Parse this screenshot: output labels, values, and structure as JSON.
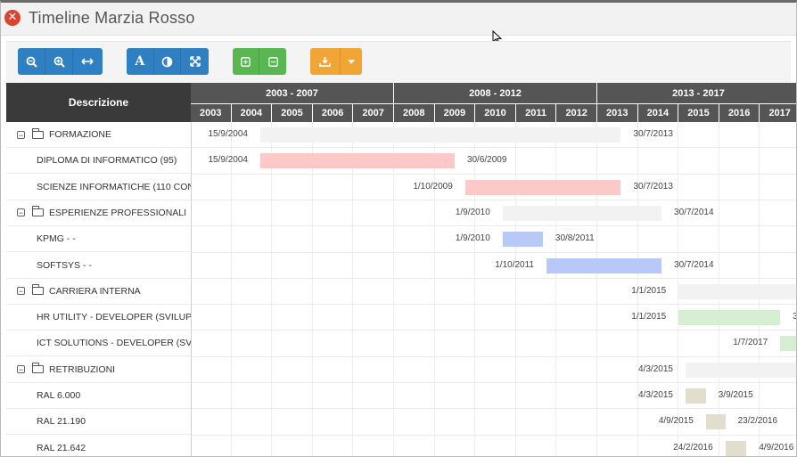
{
  "window": {
    "title": "Timeline Marzia Rosso",
    "close_icon": "close-icon"
  },
  "toolbar": {
    "zoom_out": "zoom-out-icon",
    "zoom_in": "zoom-in-icon",
    "fit": "fit-width-icon",
    "font": "A",
    "contrast": "contrast-icon",
    "fullscreen": "fullscreen-icon",
    "expand": "expand-all-icon",
    "collapse": "collapse-all-icon",
    "export": "download-icon",
    "export_menu": "caret-down-icon",
    "colors": {
      "blue": "#2f80c2",
      "green": "#58b750",
      "orange": "#f0a534"
    }
  },
  "gantt": {
    "header": "Descrizione",
    "periods": [
      "2003 - 2007",
      "2008 - 2012",
      "2013 - 2017"
    ],
    "years": [
      "2003",
      "2004",
      "2005",
      "2006",
      "2007",
      "2008",
      "2009",
      "2010",
      "2011",
      "2012",
      "2013",
      "2014",
      "2015",
      "2016",
      "2017"
    ],
    "rows": [
      {
        "type": "group",
        "label": "FORMAZIONE",
        "start": "15/9/2004",
        "end": "30/7/2013",
        "s": 2004.71,
        "e": 2013.58,
        "color": "#f2f2f2"
      },
      {
        "type": "child",
        "label": "DIPLOMA DI INFORMATICO (95)",
        "start": "15/9/2004",
        "end": "30/6/2009",
        "s": 2004.71,
        "e": 2009.49,
        "color": "#fcc8c8"
      },
      {
        "type": "child",
        "label": "SCIENZE INFORMATICHE (110 CON",
        "start": "1/10/2009",
        "end": "30/7/2013",
        "s": 2009.75,
        "e": 2013.58,
        "color": "#fcc8c8"
      },
      {
        "type": "group",
        "label": "ESPERIENZE PROFESSIONALI",
        "start": "1/9/2010",
        "end": "30/7/2014",
        "s": 2010.67,
        "e": 2014.58,
        "color": "#f2f2f2"
      },
      {
        "type": "child",
        "label": "KPMG - -",
        "start": "1/9/2010",
        "end": "30/8/2011",
        "s": 2010.67,
        "e": 2011.66,
        "color": "#b8c8f7"
      },
      {
        "type": "child",
        "label": "SOFTSYS - -",
        "start": "1/10/2011",
        "end": "30/7/2014",
        "s": 2011.75,
        "e": 2014.58,
        "color": "#b8c8f7"
      },
      {
        "type": "group",
        "label": "CARRIERA INTERNA",
        "start": "1/1/2015",
        "end": "",
        "s": 2015.0,
        "e": 2018.0,
        "color": "#f2f2f2"
      },
      {
        "type": "child",
        "label": "HR UTILITY - DEVELOPER (SVILUP",
        "start": "1/1/2015",
        "end": "3",
        "s": 2015.0,
        "e": 2017.5,
        "color": "#d6efd2"
      },
      {
        "type": "child",
        "label": "ICT SOLUTIONS - DEVELOPER (SV",
        "start": "1/7/2017",
        "end": "",
        "s": 2017.5,
        "e": 2018.0,
        "color": "#d6efd2"
      },
      {
        "type": "group",
        "label": "RETRIBUZIONI",
        "start": "4/3/2015",
        "end": "",
        "s": 2015.17,
        "e": 2018.0,
        "color": "#f2f2f2"
      },
      {
        "type": "child",
        "label": "RAL 6.000",
        "start": "4/3/2015",
        "end": "3/9/2015",
        "s": 2015.17,
        "e": 2015.67,
        "color": "#e2dece"
      },
      {
        "type": "child",
        "label": "RAL 21.190",
        "start": "4/9/2015",
        "end": "23/2/2016",
        "s": 2015.67,
        "e": 2016.15,
        "color": "#e2dece"
      },
      {
        "type": "child",
        "label": "RAL 21.642",
        "start": "24/2/2016",
        "end": "4/9/2016",
        "s": 2016.15,
        "e": 2016.67,
        "color": "#e2dece"
      }
    ]
  }
}
